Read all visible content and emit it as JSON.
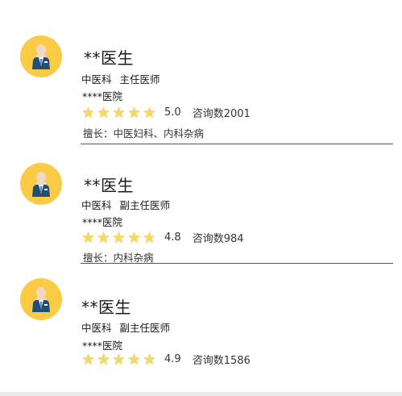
{
  "colors": {
    "avatar_bg": "#FCCB45",
    "star_on": "#F6D86A",
    "star_off": "#E3E3E3",
    "divider": "#555555"
  },
  "doctors": [
    {
      "name": "**医生",
      "department": "中医科",
      "title": "主任医师",
      "hospital": "****医院",
      "rating": 5.0,
      "rating_text": "5.0",
      "consult_label": "咨询数2001",
      "specialty": "擅长：中医妇科、内科杂病",
      "avatar_icon": "doctor-avatar-icon"
    },
    {
      "name": "**医生",
      "department": "中医科",
      "title": "副主任医师",
      "hospital": "****医院",
      "rating": 4.8,
      "rating_text": "4.8",
      "consult_label": "咨询数984",
      "specialty": "擅长：内科杂病",
      "avatar_icon": "doctor-avatar-icon"
    },
    {
      "name": "**医生",
      "department": "中医科",
      "title": "副主任医师",
      "hospital": "****医院",
      "rating": 4.9,
      "rating_text": "4.9",
      "consult_label": "咨询数1586",
      "specialty": "",
      "avatar_icon": "doctor-avatar-icon"
    }
  ]
}
